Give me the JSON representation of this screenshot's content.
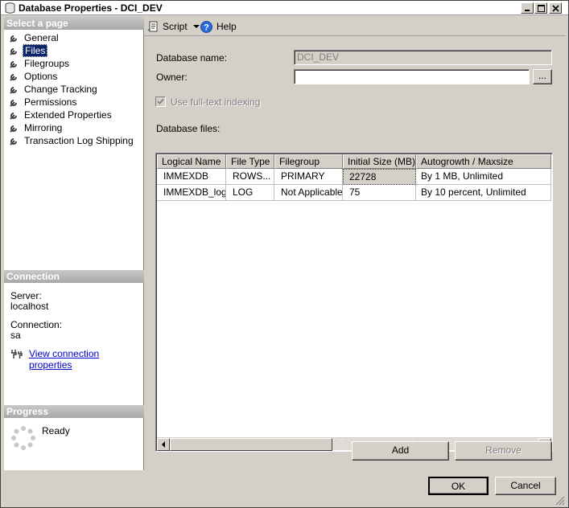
{
  "window": {
    "title": "Database Properties - DCI_DEV"
  },
  "left": {
    "select_page_header": "Select a page",
    "pages": [
      {
        "label": "General",
        "selected": false
      },
      {
        "label": "Files",
        "selected": true
      },
      {
        "label": "Filegroups",
        "selected": false
      },
      {
        "label": "Options",
        "selected": false
      },
      {
        "label": "Change Tracking",
        "selected": false
      },
      {
        "label": "Permissions",
        "selected": false
      },
      {
        "label": "Extended Properties",
        "selected": false
      },
      {
        "label": "Mirroring",
        "selected": false
      },
      {
        "label": "Transaction Log Shipping",
        "selected": false
      }
    ],
    "connection_header": "Connection",
    "server_label": "Server:",
    "server_value": "localhost",
    "connection_label": "Connection:",
    "connection_value": "sa",
    "view_connection_link": "View connection properties",
    "progress_header": "Progress",
    "progress_status": "Ready"
  },
  "toolbar": {
    "script_label": "Script",
    "help_label": "Help"
  },
  "form": {
    "database_name_label": "Database name:",
    "database_name_value": "DCI_DEV",
    "owner_label": "Owner:",
    "owner_value": "",
    "owner_browse": "...",
    "fulltext_label": "Use full-text indexing",
    "fulltext_checked": true,
    "database_files_label": "Database files:"
  },
  "grid": {
    "headers": [
      "Logical Name",
      "File Type",
      "Filegroup",
      "Initial Size (MB)",
      "Autogrowth / Maxsize"
    ],
    "rows": [
      [
        "IMMEXDB",
        "ROWS...",
        "PRIMARY",
        "22728",
        "By 1 MB, Unlimited"
      ],
      [
        "IMMEXDB_log",
        "LOG",
        "Not Applicable",
        "75",
        "By 10 percent, Unlimited"
      ]
    ]
  },
  "buttons": {
    "add": "Add",
    "remove": "Remove",
    "ok": "OK",
    "cancel": "Cancel"
  }
}
